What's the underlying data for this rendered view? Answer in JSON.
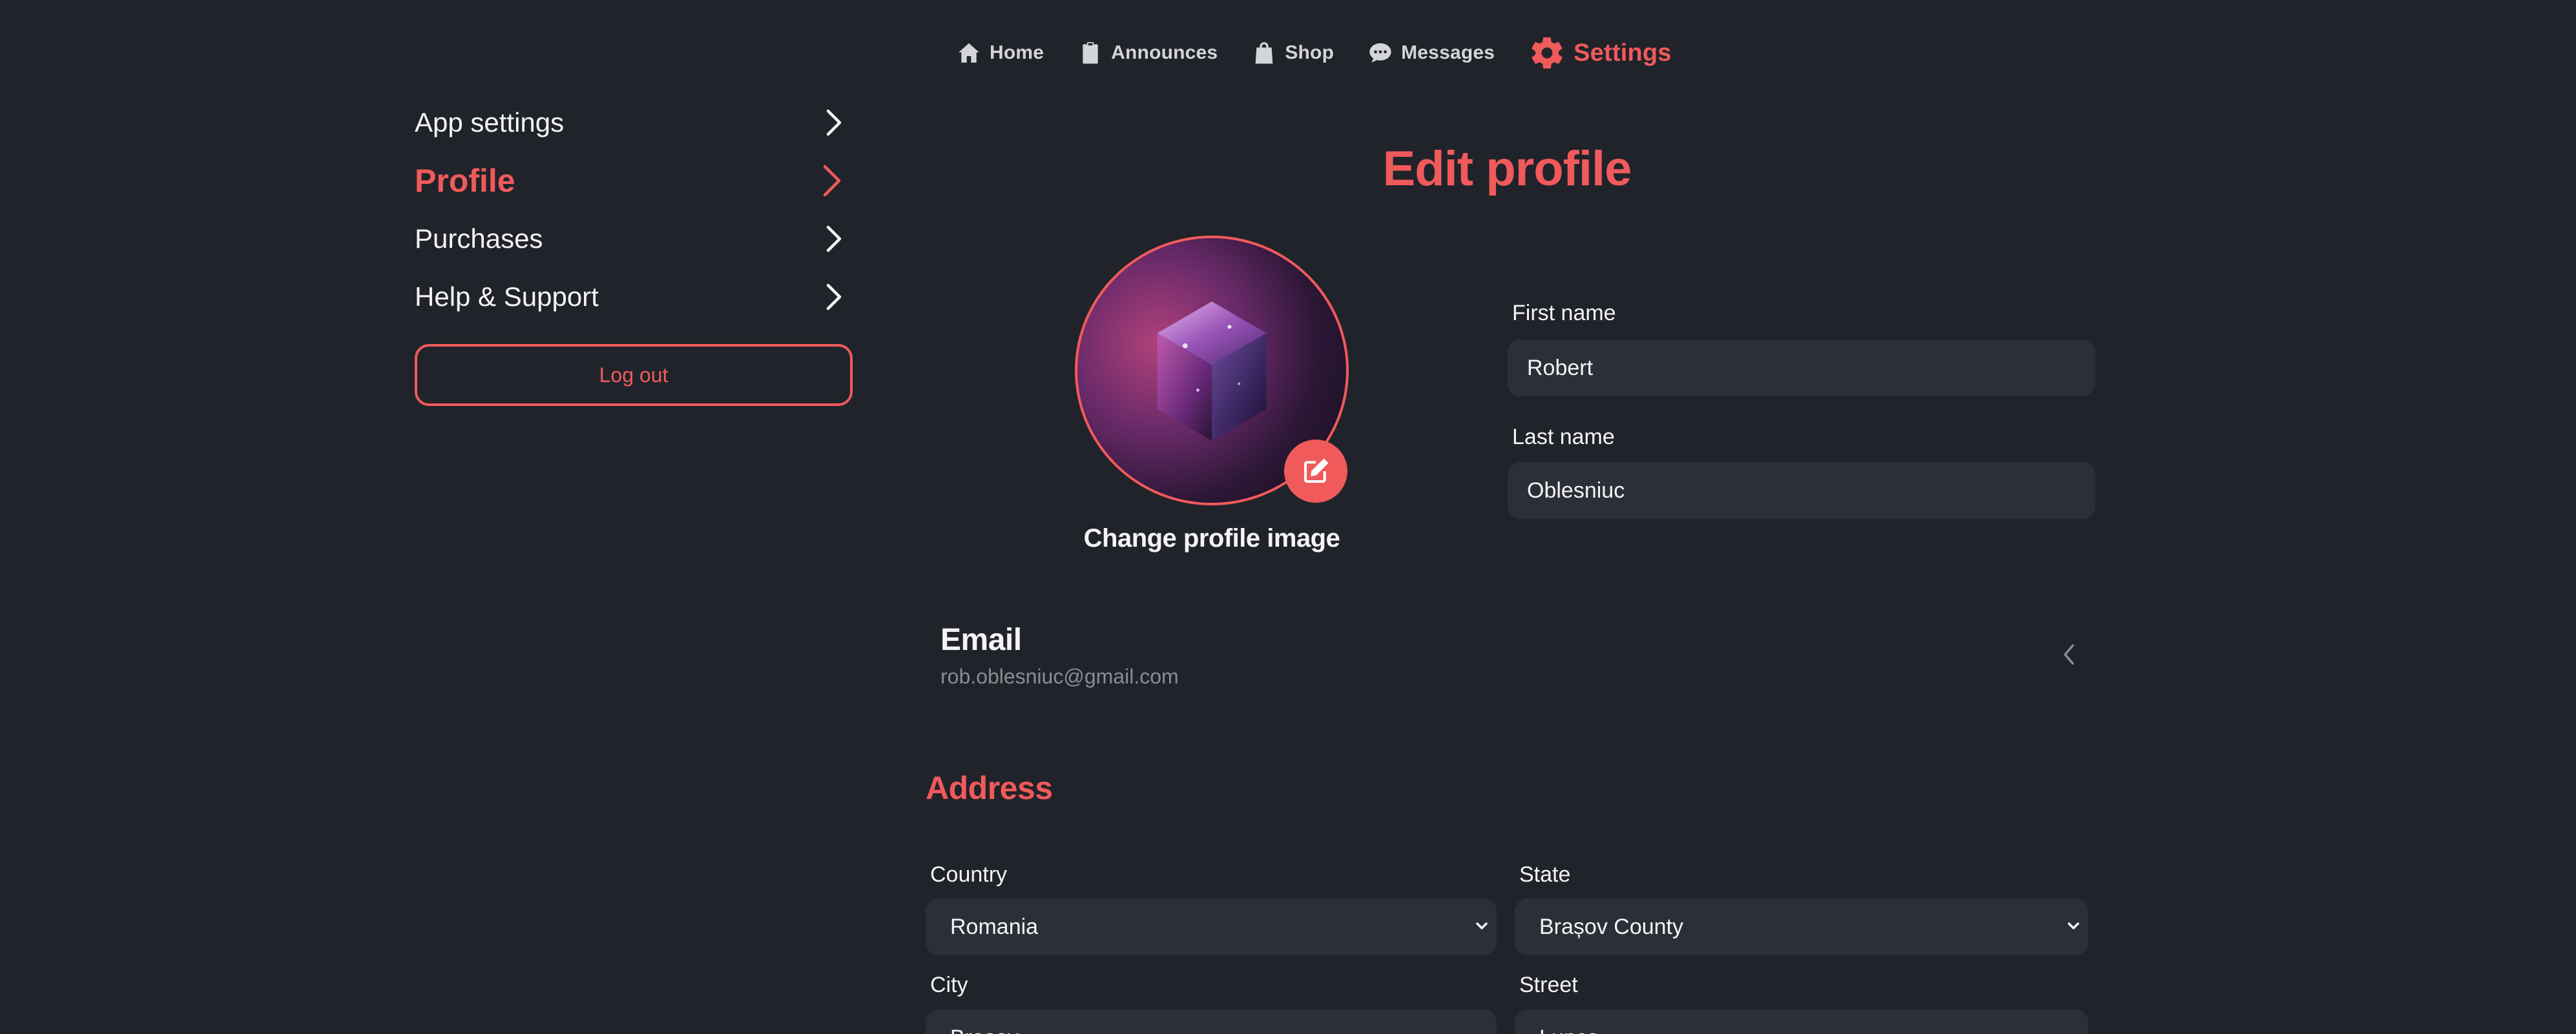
{
  "nav": {
    "items": [
      {
        "label": "Home",
        "icon": "home-icon",
        "active": false
      },
      {
        "label": "Announces",
        "icon": "clipboard-icon",
        "active": false
      },
      {
        "label": "Shop",
        "icon": "shopping-bag-icon",
        "active": false
      },
      {
        "label": "Messages",
        "icon": "chat-bubble-icon",
        "active": false
      },
      {
        "label": "Settings",
        "icon": "gear-icon",
        "active": true
      }
    ]
  },
  "sidebar": {
    "items": [
      {
        "label": "App settings",
        "icon": "chevron-right-icon",
        "active": false
      },
      {
        "label": "Profile",
        "icon": "chevron-right-icon",
        "active": true
      },
      {
        "label": "Purchases",
        "icon": "chevron-right-icon",
        "active": false
      },
      {
        "label": "Help & Support",
        "icon": "chevron-right-icon",
        "active": false
      }
    ],
    "logout_label": "Log out"
  },
  "profile": {
    "title": "Edit profile",
    "change_image_label": "Change profile image",
    "avatar_icon": "galaxy-cube-image",
    "edit_icon": "edit-icon",
    "first_name_label": "First name",
    "first_name_value": "Robert",
    "last_name_label": "Last name",
    "last_name_value": "Oblesniuc"
  },
  "email": {
    "title": "Email",
    "value": "rob.oblesniuc@gmail.com",
    "icon": "chevron-left-icon"
  },
  "address": {
    "title": "Address",
    "country_label": "Country",
    "country_value": "Romania",
    "state_label": "State",
    "state_value": "Brașov County",
    "city_label": "City",
    "city_value": "Brașov",
    "street_label": "Street",
    "street_value": "Lunca"
  },
  "colors": {
    "background": "#21232a",
    "accent": "#f05a5b",
    "input_bg": "#2c2f37",
    "text": "#f4f4f6",
    "muted": "#8a8c93"
  }
}
